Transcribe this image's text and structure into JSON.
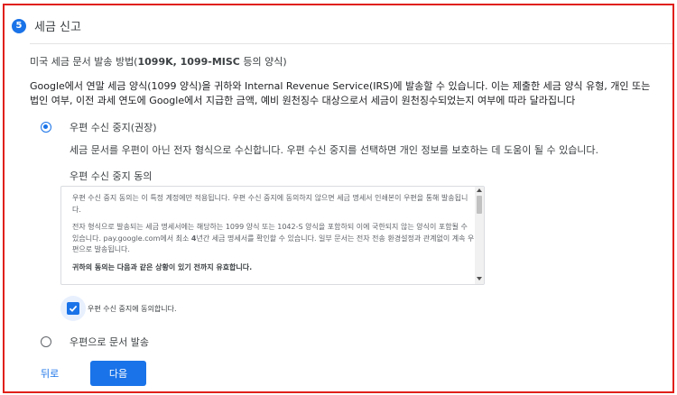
{
  "section": {
    "step_number": "5",
    "title": "세금 신고"
  },
  "subheading": {
    "prefix": "미국 세금 문서 발송 방법(",
    "bold": "1099K, 1099-MISC",
    "suffix": " 등의 양식)"
  },
  "description": "Google에서 연말 세금 양식(1099 양식)을 귀하와 Internal Revenue Service(IRS)에 발송할 수 있습니다. 이는 제출한 세금 양식 유형, 개인 또는 법인 여부, 이전 과세 연도에 Google에서 지급한 금액, 예비 원천징수 대상으로서 세금이 원천징수되었는지 여부에 따라 달라집니다",
  "options": {
    "paperless": {
      "label": "우편 수신 중지(권장)",
      "selected": true,
      "description": "세금 문서를 우편이 아닌 전자 형식으로 수신합니다. 우편 수신 중지를 선택하면 개인 정보를 보호하는 데 도움이 될 수 있습니다."
    },
    "mail": {
      "label": "우편으로 문서 발송",
      "selected": false
    }
  },
  "consent": {
    "title": "우편 수신 중지 동의",
    "paragraph1": "우편 수신 중지 동의는 이 특정 계정에만 적용됩니다.  우편 수신 중지에 동의하지 않으면 세금 명세서 인쇄본이 우편을 통해 발송됩니다.",
    "paragraph2_pre": "전자 형식으로 발송되는 세금 명세서에는 해당하는 1099 양식 또는 1042-S 양식을 포함하되 이에 국한되지 않는 양식이 포함될 수 있습니다. pay.google.com에서 최소 ",
    "paragraph2_bold": "4",
    "paragraph2_post": "년간 세금 명세서를 확인할 수 있습니다. 일부 문서는 전자 전송 환경설정과 관계없이 계속 우편으로 발송됩니다.",
    "paragraph3": "귀하의 동의는 다음과 같은 상황이 있기 전까지 유효합니다.",
    "checkbox_label": "우편 수신 중지에 동의합니다.",
    "checked": true
  },
  "buttons": {
    "back": "뒤로",
    "next": "다음"
  },
  "colors": {
    "accent": "#1a73e8",
    "frame_border": "#e0201a"
  }
}
